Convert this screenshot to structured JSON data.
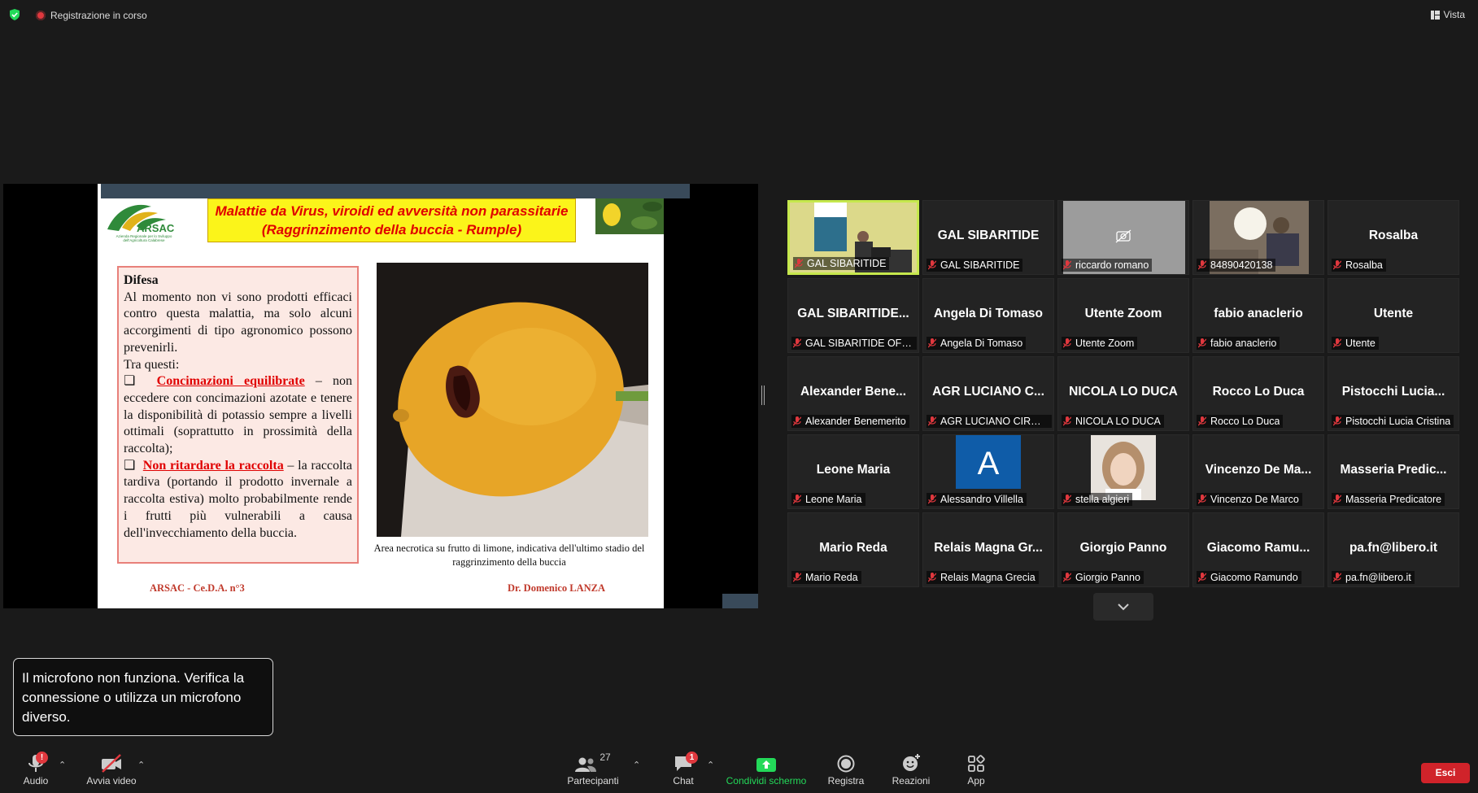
{
  "topbar": {
    "recording": "Registrazione in corso",
    "view": "Vista"
  },
  "slide": {
    "title_line1_pre": "Malattie da ",
    "title_line1_italic": "Virus",
    "title_line1_post": ", viroidi ed avversità non parassitarie",
    "title_line2": "(Raggrinzimento della buccia - Rumple)",
    "logo_text": "ARSAC",
    "logo_subtitle": "Azienda Regionale per lo Sviluppo dell'Agricoltura Calabrese",
    "defense_heading": "Difesa",
    "defense_p1": "Al momento non vi sono prodotti efficaci contro questa malattia, ma solo alcuni accorgimenti di tipo agronomico possono prevenirli.",
    "defense_p2": "Tra questi:",
    "bullet1_red": "Concimazioni equilibrate",
    "bullet1_text": " – non eccedere con concimazioni azotate e tenere la disponibilità di potassio sempre a livelli ottimali (soprattutto in prossimità della raccolta);",
    "bullet2_red": "Non ritardare la raccolta",
    "bullet2_text": " – la raccolta tardiva (portando il prodotto invernale a raccolta estiva) molto probabilmente rende i frutti più vulnerabili a causa dell'invecchiamento della buccia.",
    "caption": "Area necrotica su frutto di limone, indicativa dell'ultimo stadio del raggrinzimento della buccia",
    "footer_left": "ARSAC - Ce.D.A. n°3",
    "footer_right": "Dr. Domenico LANZA"
  },
  "participants": [
    {
      "big": "",
      "label": "GAL SIBARITIDE",
      "video": "room",
      "active": true
    },
    {
      "big": "GAL SIBARITIDE",
      "label": "GAL SIBARITIDE"
    },
    {
      "big": "",
      "label": "riccardo romano",
      "video": "camoff"
    },
    {
      "big": "",
      "label": "84890420138",
      "video": "webcam"
    },
    {
      "big": "Rosalba",
      "label": "Rosalba"
    },
    {
      "big": "GAL SIBARITIDE...",
      "label": "GAL SIBARITIDE OFFICE"
    },
    {
      "big": "Angela Di Tomaso",
      "label": "Angela Di Tomaso"
    },
    {
      "big": "Utente Zoom",
      "label": "Utente Zoom"
    },
    {
      "big": "fabio anaclerio",
      "label": "fabio anaclerio"
    },
    {
      "big": "Utente",
      "label": "Utente"
    },
    {
      "big": "Alexander Bene...",
      "label": "Alexander Benemerito"
    },
    {
      "big": "AGR LUCIANO C...",
      "label": "AGR LUCIANO CIROL..."
    },
    {
      "big": "NICOLA LO DUCA",
      "label": "NICOLA LO DUCA"
    },
    {
      "big": "Rocco Lo Duca",
      "label": "Rocco Lo Duca"
    },
    {
      "big": "Pistocchi Lucia...",
      "label": "Pistocchi Lucia Cristina"
    },
    {
      "big": "Leone Maria",
      "label": "Leone Maria"
    },
    {
      "big": "",
      "label": "Alessandro Villella",
      "video": "avatarA",
      "avatar_letter": "A"
    },
    {
      "big": "",
      "label": "stella algieri",
      "video": "photo"
    },
    {
      "big": "Vincenzo De Ma...",
      "label": "Vincenzo De Marco"
    },
    {
      "big": "Masseria Predic...",
      "label": "Masseria Predicatore"
    },
    {
      "big": "Mario Reda",
      "label": "Mario Reda"
    },
    {
      "big": "Relais Magna Gr...",
      "label": "Relais Magna Grecia"
    },
    {
      "big": "Giorgio Panno",
      "label": "Giorgio Panno"
    },
    {
      "big": "Giacomo Ramu...",
      "label": "Giacomo Ramundo"
    },
    {
      "big": "pa.fn@libero.it",
      "label": "pa.fn@libero.it"
    }
  ],
  "toast": {
    "text": "Il microfono non funziona. Verifica la connessione o utilizza un microfono diverso."
  },
  "toolbar": {
    "audio": "Audio",
    "video": "Avvia video",
    "participants": "Partecipanti",
    "participants_count": "27",
    "chat": "Chat",
    "chat_badge": "1",
    "share": "Condividi schermo",
    "record": "Registra",
    "reactions": "Reazioni",
    "apps": "App",
    "leave": "Esci",
    "audio_badge": "!"
  },
  "colors": {
    "active_border": "#c6e84d",
    "share_green": "#23d959",
    "leave_red": "#d0232a",
    "title_yellow": "#fbf41a",
    "slide_red": "#e00000"
  }
}
